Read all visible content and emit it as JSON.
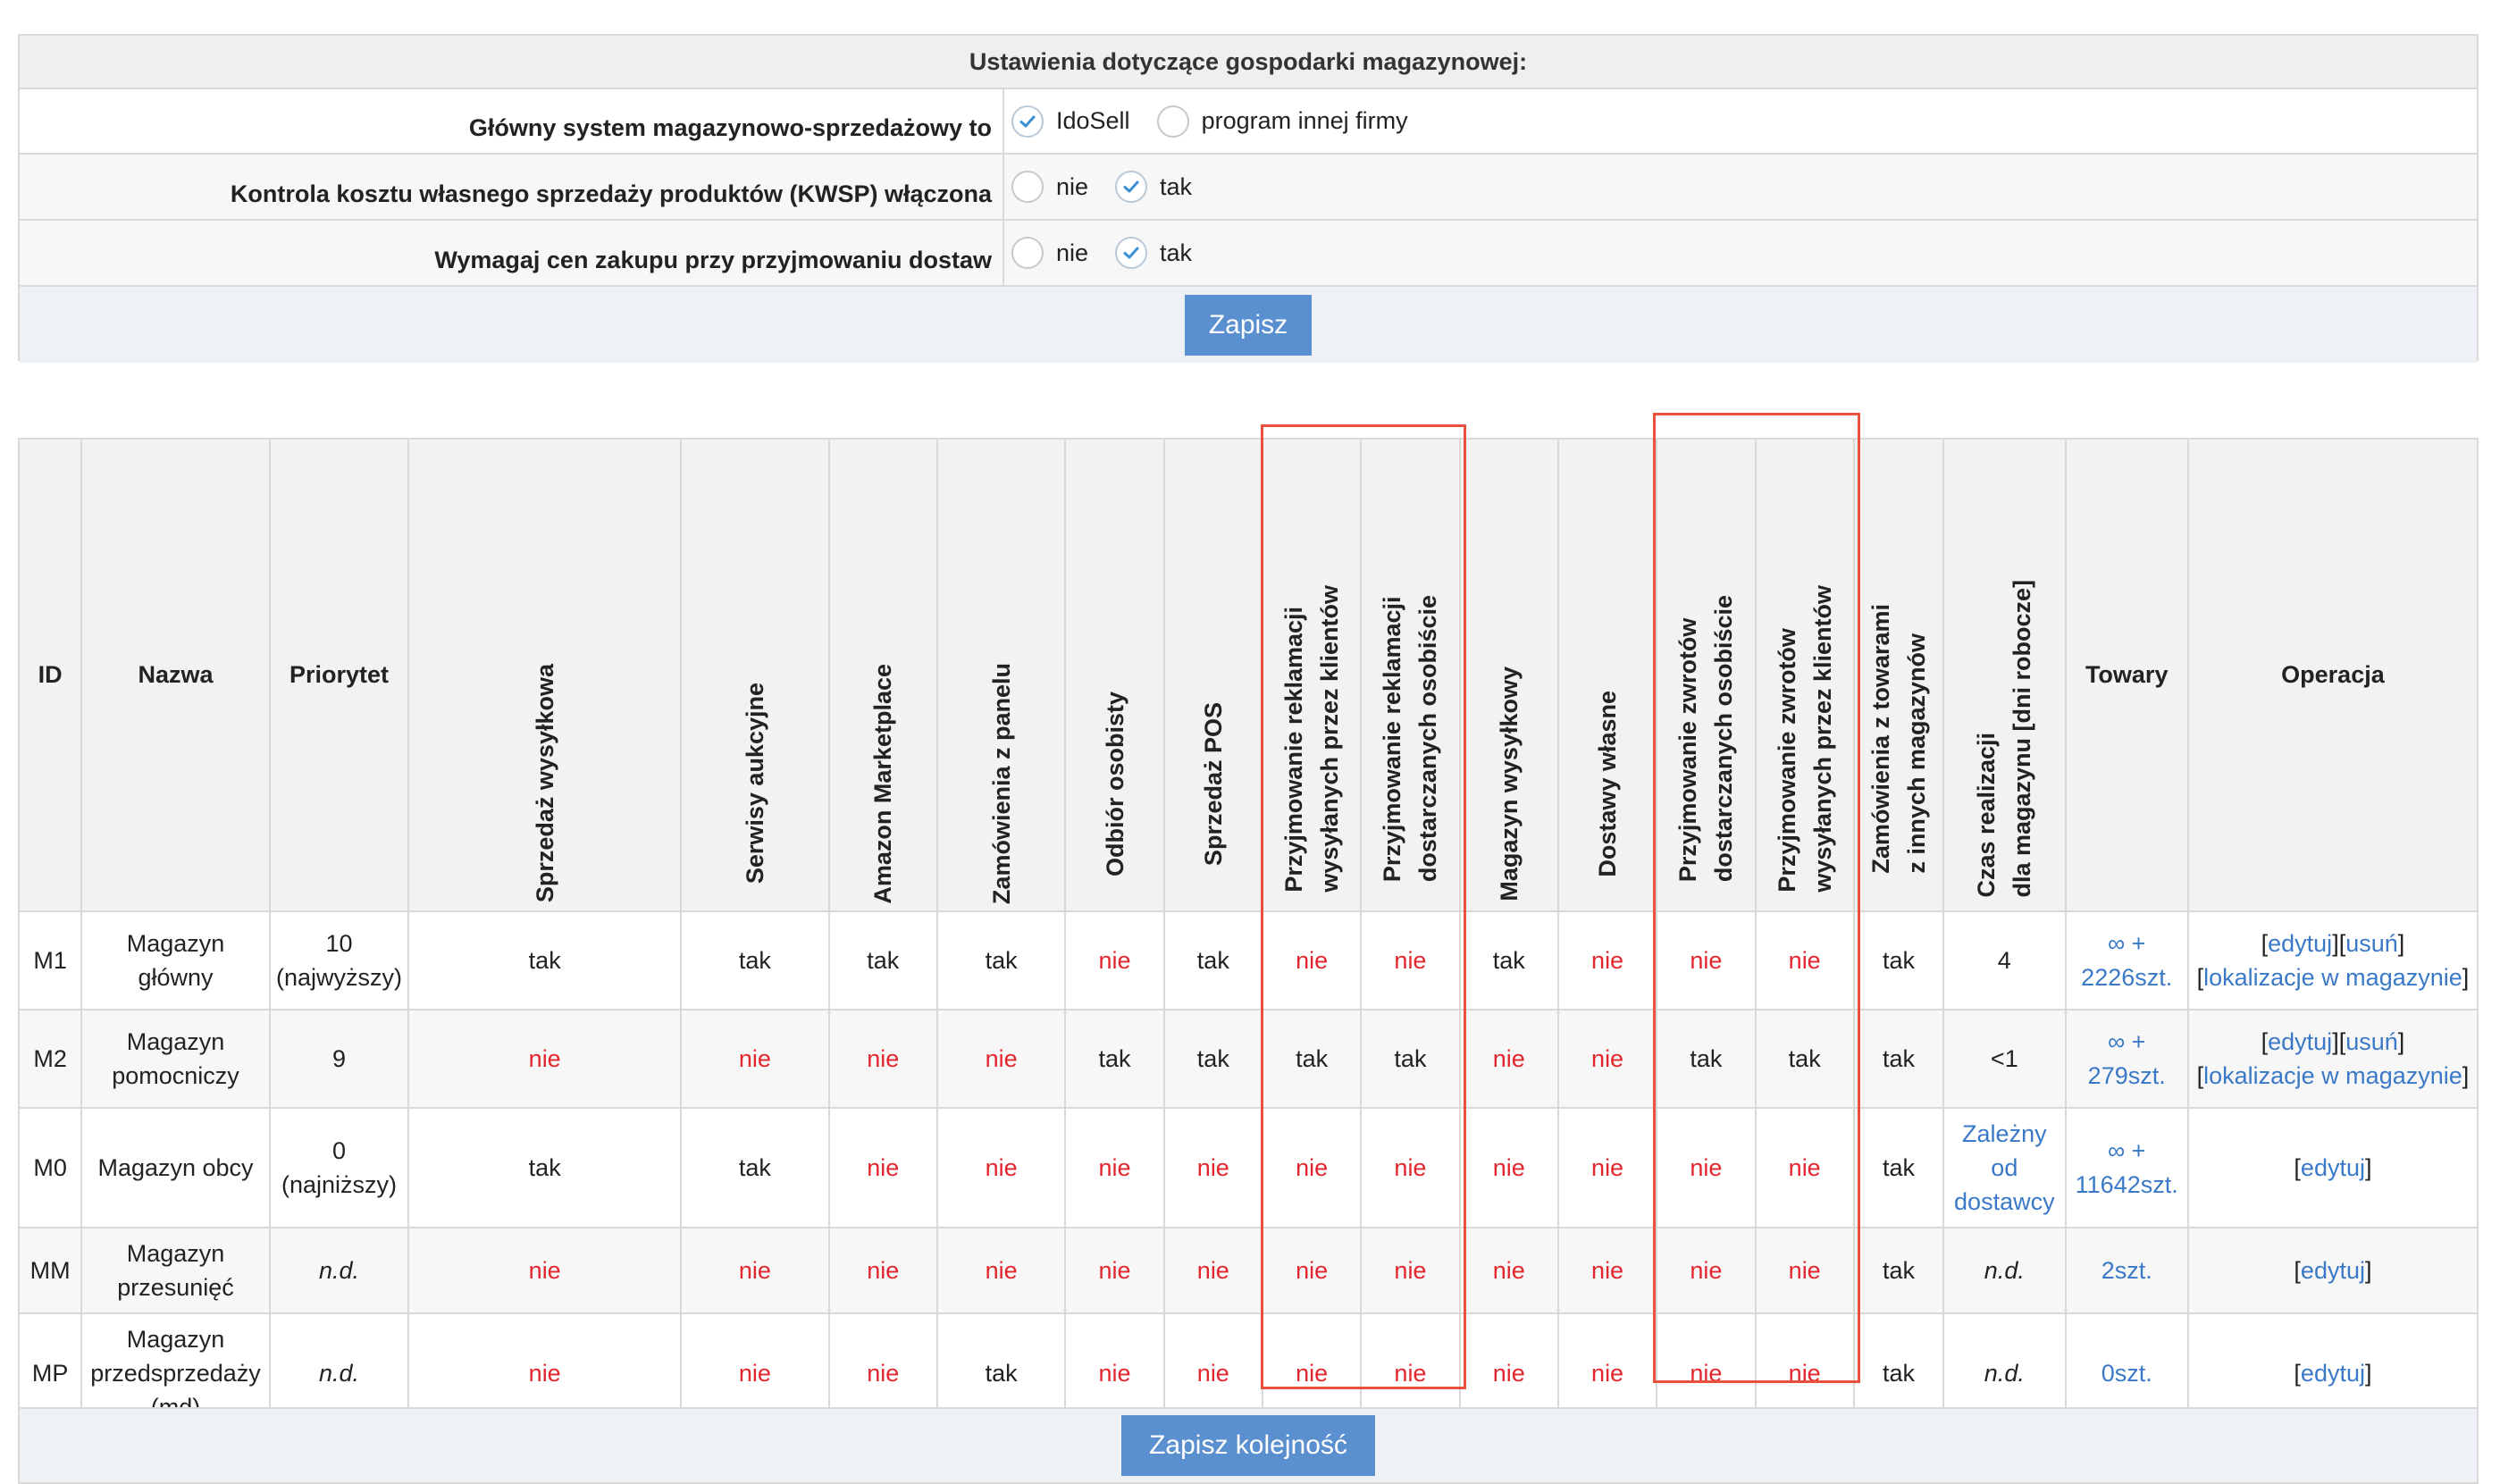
{
  "settings": {
    "title": "Ustawienia dotyczące gospodarki magazynowej:",
    "rows": [
      {
        "label": "Główny system magazynowo-sprzedażowy to",
        "options": [
          "IdoSell",
          "program innej firmy"
        ],
        "selected": 0
      },
      {
        "label": "Kontrola kosztu własnego sprzedaży produktów (KWSP) włączona",
        "options": [
          "nie",
          "tak"
        ],
        "selected": 1
      },
      {
        "label": "Wymagaj cen zakupu przy przyjmowaniu dostaw",
        "options": [
          "nie",
          "tak"
        ],
        "selected": 1
      }
    ],
    "save_label": "Zapisz"
  },
  "table": {
    "headers": {
      "id": "ID",
      "name": "Nazwa",
      "priority": "Priorytet",
      "c1": "Sprzedaż wysyłkowa",
      "c2": "Serwisy aukcyjne",
      "c3": "Amazon Marketplace",
      "c4": "Zamówienia z panelu",
      "c5": "Odbiór osobisty",
      "c6": "Sprzedaż POS",
      "c7a": "Przyjmowanie reklamacji",
      "c7b": "wysyłanych przez klientów",
      "c8a": "Przyjmowanie reklamacji",
      "c8b": "dostarczanych osobiście",
      "c9": "Magazyn wysyłkowy",
      "c10": "Dostawy własne",
      "c11a": "Przyjmowanie zwrotów",
      "c11b": "dostarczanych osobiście",
      "c12a": "Przyjmowanie zwrotów",
      "c12b": "wysyłanych przez klientów",
      "c13a": "Zamówienia z towarami",
      "c13b": "z innych magazynów",
      "c14a": "Czas realizacji",
      "c14b": "dla magazynu [dni robocze]",
      "goods": "Towary",
      "ops": "Operacja"
    },
    "rows": [
      {
        "id": "M1",
        "name_l1": "Magazyn",
        "name_l2": "główny",
        "prio_l1": "10",
        "prio_l2": "(najwyższy)",
        "c1": "tak",
        "c2": "tak",
        "c3": "tak",
        "c4": "tak",
        "c5": "nie",
        "c6": "tak",
        "c7": "nie",
        "c8": "nie",
        "c9": "tak",
        "c10": "nie",
        "c11": "nie",
        "c12": "nie",
        "c13": "tak",
        "c14": "4",
        "goods_l1": "∞ +",
        "goods_l2": "2226szt.",
        "op_edit": "edytuj",
        "op_delete": "usuń",
        "op_loc": "lokalizacje w magazynie"
      },
      {
        "id": "M2",
        "name_l1": "Magazyn",
        "name_l2": "pomocniczy",
        "prio": "9",
        "c1": "nie",
        "c2": "nie",
        "c3": "nie",
        "c4": "nie",
        "c5": "tak",
        "c6": "tak",
        "c7": "tak",
        "c8": "tak",
        "c9": "nie",
        "c10": "nie",
        "c11": "tak",
        "c12": "tak",
        "c13": "tak",
        "c14": "<1",
        "goods_l1": "∞ +",
        "goods_l2": "279szt.",
        "op_edit": "edytuj",
        "op_delete": "usuń",
        "op_loc": "lokalizacje w magazynie"
      },
      {
        "id": "M0",
        "name": "Magazyn obcy",
        "prio_l1": "0",
        "prio_l2": "(najniższy)",
        "c1": "tak",
        "c2": "tak",
        "c3": "nie",
        "c4": "nie",
        "c5": "nie",
        "c6": "nie",
        "c7": "nie",
        "c8": "nie",
        "c9": "nie",
        "c10": "nie",
        "c11": "nie",
        "c12": "nie",
        "c13": "tak",
        "c14_l1": "Zależny",
        "c14_l2": "od",
        "c14_l3": "dostawcy",
        "goods_l1": "∞ +",
        "goods_l2": "11642szt.",
        "op_edit": "edytuj"
      },
      {
        "id": "MM",
        "name_l1": "Magazyn",
        "name_l2": "przesunięć",
        "prio": "n.d.",
        "c1": "nie",
        "c2": "nie",
        "c3": "nie",
        "c4": "nie",
        "c5": "nie",
        "c6": "nie",
        "c7": "nie",
        "c8": "nie",
        "c9": "nie",
        "c10": "nie",
        "c11": "nie",
        "c12": "nie",
        "c13": "tak",
        "c14": "n.d.",
        "goods": "2szt.",
        "op_edit": "edytuj"
      },
      {
        "id": "MP",
        "name_l1": "Magazyn",
        "name_l2": "przedsprzedaży",
        "name_l3": "(md)",
        "prio": "n.d.",
        "c1": "nie",
        "c2": "nie",
        "c3": "nie",
        "c4": "tak",
        "c5": "nie",
        "c6": "nie",
        "c7": "nie",
        "c8": "nie",
        "c9": "nie",
        "c10": "nie",
        "c11": "nie",
        "c12": "nie",
        "c13": "tak",
        "c14": "n.d.",
        "goods": "0szt.",
        "op_edit": "edytuj"
      }
    ]
  },
  "save_order_label": "Zapisz kolejność",
  "colors": {
    "accent": "#5a8fd0",
    "no": "#e3262e",
    "link": "#3a79c7",
    "highlight": "#e8523c"
  }
}
